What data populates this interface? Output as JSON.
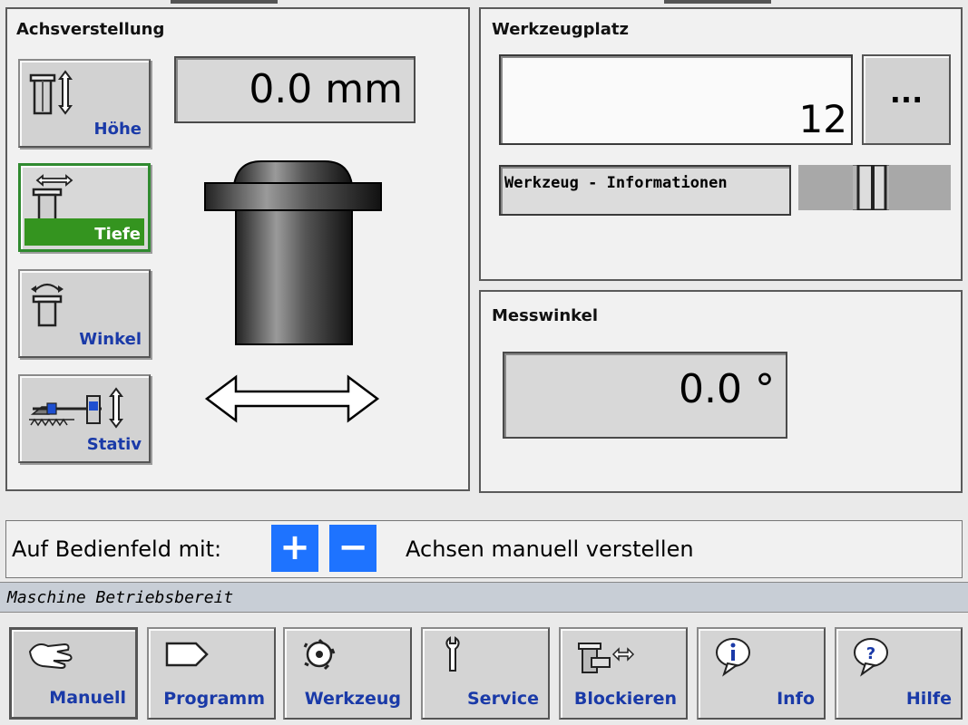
{
  "axis_panel": {
    "title": "Achsverstellung",
    "buttons": [
      {
        "label": "Höhe"
      },
      {
        "label": "Tiefe"
      },
      {
        "label": "Winkel"
      },
      {
        "label": "Stativ"
      }
    ],
    "value": "0.0 mm"
  },
  "tool_panel": {
    "title": "Werkzeugplatz",
    "place_number": "12",
    "browse_label": "...",
    "info_label": "Werkzeug - Informationen"
  },
  "angle_panel": {
    "title": "Messwinkel",
    "value": "0.0 °"
  },
  "instruction": {
    "prefix": "Auf Bedienfeld mit:",
    "plus": "+",
    "minus": "−",
    "suffix": "Achsen manuell verstellen"
  },
  "status": {
    "text": "Maschine Betriebsbereit"
  },
  "toolbar": {
    "items": [
      {
        "label": "Manuell",
        "icon": "hand-icon"
      },
      {
        "label": "Programm",
        "icon": "program-icon"
      },
      {
        "label": "Werkzeug",
        "icon": "cutter-icon"
      },
      {
        "label": "Service",
        "icon": "wrench-icon"
      },
      {
        "label": "Blockieren",
        "icon": "block-icon"
      },
      {
        "label": "Info",
        "icon": "info-icon"
      },
      {
        "label": "Hilfe",
        "icon": "help-icon"
      }
    ]
  },
  "colors": {
    "accent_blue": "#1a3aa8",
    "active_green": "#34941f",
    "pm_blue": "#1e73ff"
  }
}
